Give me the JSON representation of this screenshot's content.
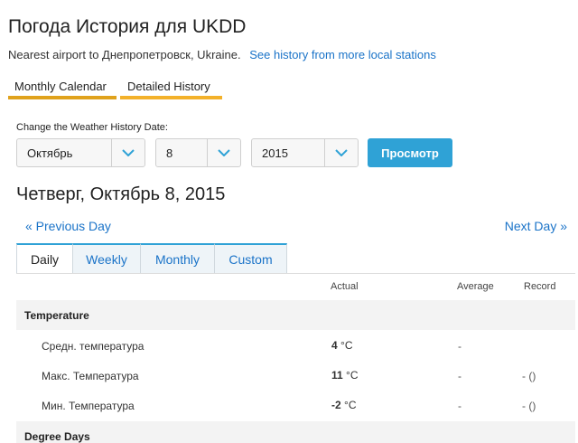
{
  "header": {
    "title": "Погода История для UKDD",
    "nearest_text": "Nearest airport to Днепропетровск, Ukraine.",
    "more_stations_link": "See history from more local stations"
  },
  "history_tabs": [
    {
      "label": "Monthly Calendar"
    },
    {
      "label": "Detailed History"
    }
  ],
  "date_form": {
    "label": "Change the Weather History Date:",
    "month": "Октябрь",
    "day": "8",
    "year": "2015",
    "submit_label": "Просмотр"
  },
  "date_heading": "Четверг, Октябрь 8, 2015",
  "nav": {
    "previous": "« Previous Day",
    "next": "Next Day »"
  },
  "period_tabs": [
    {
      "label": "Daily",
      "active": true
    },
    {
      "label": "Weekly",
      "active": false
    },
    {
      "label": "Monthly",
      "active": false
    },
    {
      "label": "Custom",
      "active": false
    }
  ],
  "table": {
    "columns": {
      "actual": "Actual",
      "average": "Average",
      "record": "Record"
    },
    "sections": [
      {
        "title": "Temperature",
        "rows": [
          {
            "label": "Средн. температура",
            "actual": "4",
            "unit": "°C",
            "average": "-",
            "record": ""
          },
          {
            "label": "Макс. Температура",
            "actual": "11",
            "unit": "°C",
            "average": "-",
            "record": "- ()"
          },
          {
            "label": "Мин. Температура",
            "actual": "-2",
            "unit": "°C",
            "average": "-",
            "record": "- ()"
          }
        ]
      },
      {
        "title": "Degree Days",
        "rows": []
      }
    ]
  },
  "colors": {
    "link": "#1a73c8",
    "accent": "#2fa2d6",
    "tab_underline": "#e0a21c"
  },
  "icons": {
    "select_arrow": "chevron-down-icon"
  }
}
